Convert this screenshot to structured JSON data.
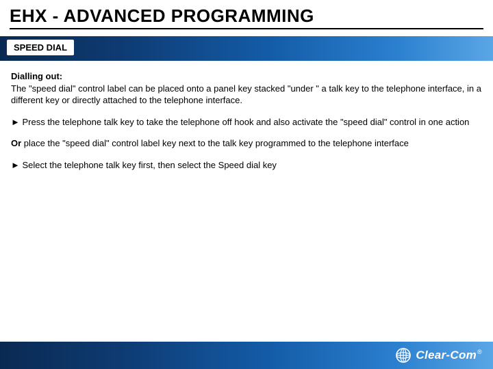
{
  "title": "EHX - ADVANCED PROGRAMMING",
  "tab_label": "SPEED DIAL",
  "content": {
    "heading": "Dialling out:",
    "p1": "The \"speed dial\" control label can be placed onto a panel key stacked \"under \" a talk key to the telephone interface, in a different key or directly attached to the telephone interface.",
    "p2": "► Press the telephone talk key to take the telephone off hook and also activate the \"speed dial\" control in one action",
    "p3_lead": "Or",
    "p3_rest": " place the \"speed dial\" control label key next to the talk key programmed to the telephone interface",
    "p4": "► Select the telephone talk key first, then select the Speed dial key"
  },
  "logo": {
    "text": "Clear-Com",
    "reg": "®"
  }
}
